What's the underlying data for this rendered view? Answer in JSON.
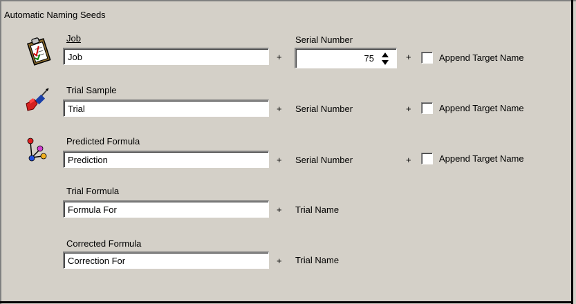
{
  "group": {
    "title": "Automatic Naming Seeds"
  },
  "rows": {
    "job": {
      "label": "Job",
      "value": "Job",
      "serial_label": "Serial Number",
      "serial_value": "75",
      "plus": "+",
      "plus2": "+",
      "append_label": "Append Target Name",
      "icon": "clipboard-icon"
    },
    "trial_sample": {
      "label": "Trial Sample",
      "value": "Trial",
      "suffix": "Serial Number",
      "plus": "+",
      "plus2": "+",
      "append_label": "Append Target Name",
      "icon": "dart-icon"
    },
    "predicted_formula": {
      "label": "Predicted Formula",
      "value": "Prediction",
      "suffix": "Serial Number",
      "plus": "+",
      "plus2": "+",
      "append_label": "Append Target Name",
      "icon": "molecule-icon"
    },
    "trial_formula": {
      "label": "Trial Formula",
      "value": "Formula For",
      "suffix": "Trial Name",
      "plus": "+"
    },
    "corrected_formula": {
      "label": "Corrected Formula",
      "value": "Correction For",
      "suffix": "Trial Name",
      "plus": "+"
    }
  }
}
